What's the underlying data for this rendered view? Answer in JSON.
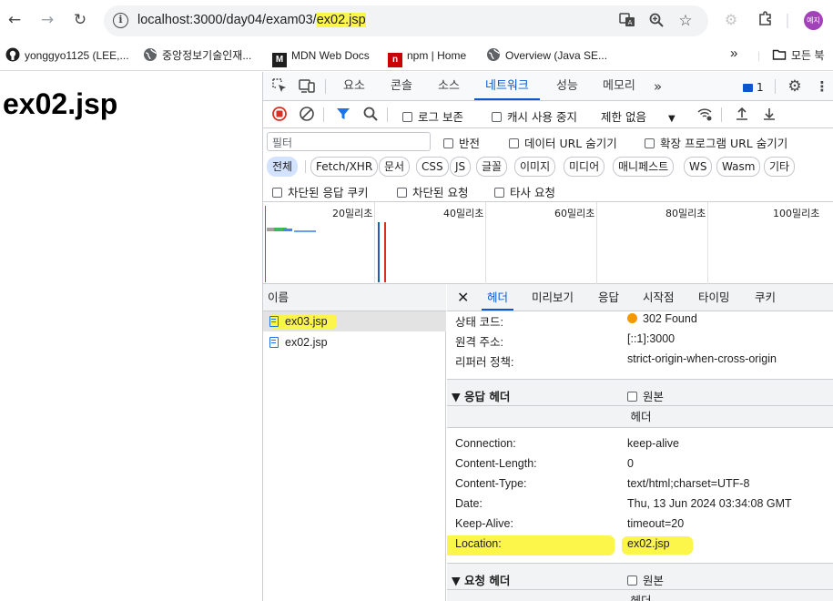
{
  "browser": {
    "url_prefix": "localhost:3000/day04/exam03/",
    "url_highlight": "ex02.jsp",
    "profile_label": "예지",
    "bookmarks": [
      {
        "label": "yonggyo1125 (LEE,..."
      },
      {
        "label": "중앙정보기술인재..."
      },
      {
        "label": "MDN Web Docs"
      },
      {
        "label": "npm | Home"
      },
      {
        "label": "Overview (Java SE..."
      }
    ],
    "more_bookmarks": "»",
    "all_bookmarks": "모든 북"
  },
  "page": {
    "heading": "ex02.jsp"
  },
  "devtools": {
    "tabs": [
      "요소",
      "콘솔",
      "소스",
      "네트워크",
      "성능",
      "메모리"
    ],
    "more_tabs": "»",
    "issues_count": "1",
    "toolbar": {
      "preserve_log": "로그 보존",
      "disable_cache": "캐시 사용 중지",
      "throttle": "제한 없음"
    },
    "filter": {
      "placeholder": "필터",
      "invert": "반전",
      "hide_data_urls": "데이터 URL 숨기기",
      "hide_ext_urls": "확장 프로그램 URL 숨기기"
    },
    "types": [
      "전체",
      "Fetch/XHR",
      "문서",
      "CSS",
      "JS",
      "글꼴",
      "이미지",
      "미디어",
      "매니페스트",
      "WS",
      "Wasm",
      "기타"
    ],
    "block": {
      "blocked_cookies": "차단된 응답 쿠키",
      "blocked_requests": "차단된 요청",
      "third_party": "타사 요청"
    },
    "overview_ticks": [
      "20밀리초",
      "40밀리초",
      "60밀리초",
      "80밀리초",
      "100밀리초"
    ],
    "request_list": {
      "header": "이름",
      "rows": [
        "ex03.jsp",
        "ex02.jsp"
      ]
    },
    "details": {
      "tabs": [
        "헤더",
        "미리보기",
        "응답",
        "시작점",
        "타이밍",
        "쿠키"
      ],
      "general": [
        {
          "key": "상태 코드:",
          "value": "302 Found"
        },
        {
          "key": "원격 주소:",
          "value": "[::1]:3000"
        },
        {
          "key": "리퍼러 정책:",
          "value": "strict-origin-when-cross-origin"
        }
      ],
      "response_section": {
        "title": "▼ 응답 헤더",
        "raw": "원본",
        "sub": "헤더"
      },
      "response_headers": [
        {
          "key": "Connection:",
          "value": "keep-alive"
        },
        {
          "key": "Content-Length:",
          "value": "0"
        },
        {
          "key": "Content-Type:",
          "value": "text/html;charset=UTF-8"
        },
        {
          "key": "Date:",
          "value": "Thu, 13 Jun 2024 03:34:08 GMT"
        },
        {
          "key": "Keep-Alive:",
          "value": "timeout=20"
        },
        {
          "key": "Location:",
          "value": "ex02.jsp"
        }
      ],
      "request_section": {
        "title": "▼ 요청 헤더",
        "raw": "원본",
        "sub": "헤더"
      }
    }
  },
  "colors": {
    "accent": "#0b57d0",
    "highlight": "#fcf54a",
    "status_dot": "#f29900"
  }
}
